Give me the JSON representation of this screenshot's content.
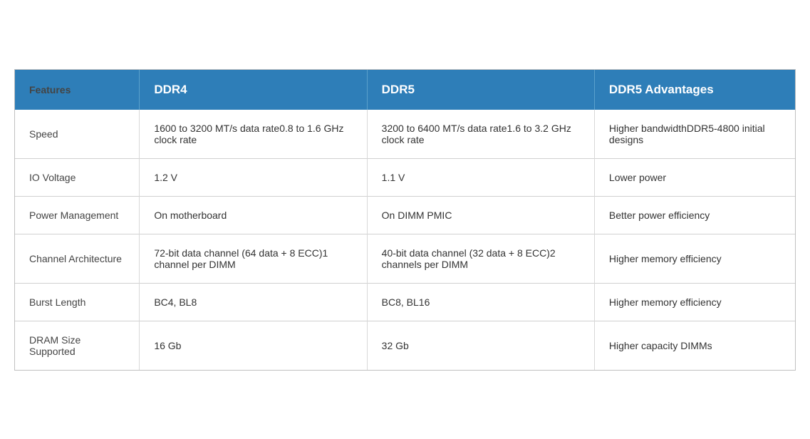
{
  "header": {
    "col1": "Features",
    "col2": "DDR4",
    "col3": "DDR5",
    "col4": "DDR5 Advantages"
  },
  "rows": [
    {
      "feature": "Speed",
      "ddr4_line1": "1600 to 3200 MT/s data rate",
      "ddr4_line2": "0.8 to 1.6 GHz clock rate",
      "ddr5_line1": "3200 to 6400 MT/s data rate",
      "ddr5_line2": "1.6 to 3.2 GHz clock rate",
      "advantage_line1": "Higher bandwidth",
      "advantage_line2": "DDR5-4800 initial designs",
      "multiline": true
    },
    {
      "feature": "IO Voltage",
      "ddr4_line1": "1.2 V",
      "ddr4_line2": null,
      "ddr5_line1": "1.1 V",
      "ddr5_line2": null,
      "advantage_line1": "Lower power",
      "advantage_line2": null,
      "multiline": false
    },
    {
      "feature": "Power Management",
      "ddr4_line1": "On motherboard",
      "ddr4_line2": null,
      "ddr5_line1": "On DIMM PMIC",
      "ddr5_line2": null,
      "advantage_line1": "Better power efficiency",
      "advantage_line2": null,
      "multiline": false
    },
    {
      "feature": "Channel Architecture",
      "ddr4_line1": "72-bit data channel (64 data + 8 ECC)",
      "ddr4_line2": "1 channel per DIMM",
      "ddr5_line1": "40-bit data channel (32 data + 8 ECC)",
      "ddr5_line2": "2 channels per DIMM",
      "advantage_line1": "Higher memory efficiency",
      "advantage_line2": null,
      "multiline": true
    },
    {
      "feature": "Burst Length",
      "ddr4_line1": "BC4, BL8",
      "ddr4_line2": null,
      "ddr5_line1": "BC8, BL16",
      "ddr5_line2": null,
      "advantage_line1": "Higher memory efficiency",
      "advantage_line2": null,
      "multiline": false
    },
    {
      "feature": "DRAM Size Supported",
      "ddr4_line1": "16 Gb",
      "ddr4_line2": null,
      "ddr5_line1": "32 Gb",
      "ddr5_line2": null,
      "advantage_line1": "Higher capacity DIMMs",
      "advantage_line2": null,
      "multiline": false
    }
  ]
}
